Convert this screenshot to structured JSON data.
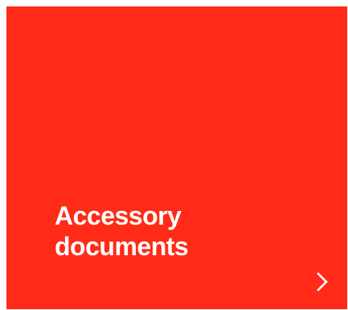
{
  "tile": {
    "title_line1": "Accessory",
    "title_line2": "documents",
    "background_color": "#ff2a17",
    "text_color": "#ffffff",
    "arrow_icon": "chevron-right-icon"
  }
}
